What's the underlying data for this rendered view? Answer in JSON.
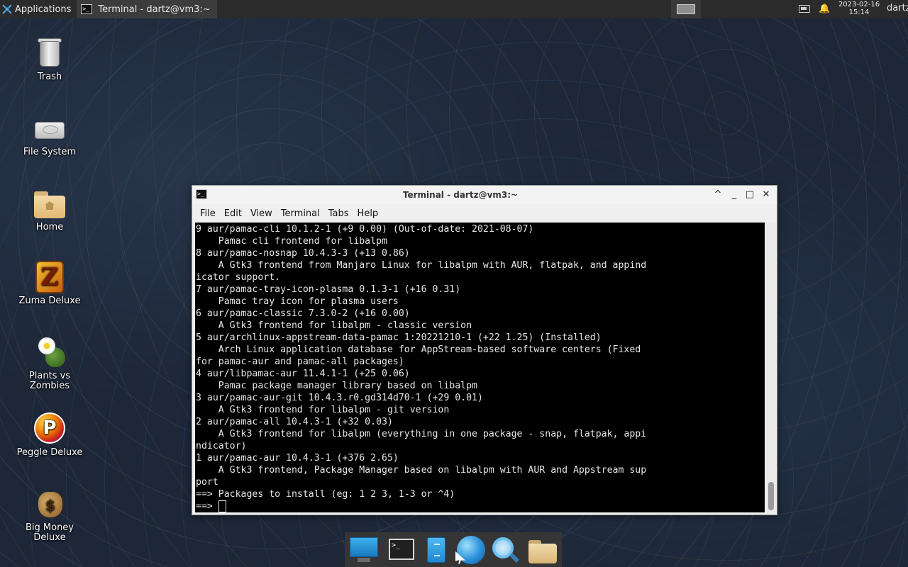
{
  "top_panel": {
    "applications_label": "Applications",
    "task_title": "Terminal - dartz@vm3:~",
    "clock_date": "2023-02-16",
    "clock_time": "15:14",
    "user": "dartz",
    "icons": [
      "applications-icon",
      "terminal-icon",
      "workspace-icon",
      "battery-icon",
      "notification-bell-icon"
    ]
  },
  "desktop_icons": [
    {
      "label": "Trash",
      "icon": "trash-icon"
    },
    {
      "label": "File System",
      "icon": "drive-icon"
    },
    {
      "label": "Home",
      "icon": "home-folder-icon"
    },
    {
      "label": "Zuma Deluxe",
      "icon": "zuma-icon"
    },
    {
      "label": "Plants vs Zombies",
      "icon": "plants-vs-zombies-icon"
    },
    {
      "label": "Peggle Deluxe",
      "icon": "peggle-icon"
    },
    {
      "label": "Big Money Deluxe",
      "icon": "money-bag-icon"
    }
  ],
  "window": {
    "title": "Terminal - dartz@vm3:~",
    "buttons": {
      "up": "^",
      "minimize": "_",
      "maximize": "□",
      "close": "✕"
    },
    "menu": [
      "File",
      "Edit",
      "View",
      "Terminal",
      "Tabs",
      "Help"
    ],
    "terminal_lines": [
      "9 aur/pamac-cli 10.1.2-1 (+9 0.00) (Out-of-date: 2021-08-07)",
      "    Pamac cli frontend for libalpm",
      "8 aur/pamac-nosnap 10.4.3-3 (+13 0.86)",
      "    A Gtk3 frontend from Manjaro Linux for libalpm with AUR, flatpak, and appind",
      "icator support.",
      "7 aur/pamac-tray-icon-plasma 0.1.3-1 (+16 0.31)",
      "    Pamac tray icon for plasma users",
      "6 aur/pamac-classic 7.3.0-2 (+16 0.00)",
      "    A Gtk3 frontend for libalpm - classic version",
      "5 aur/archlinux-appstream-data-pamac 1:20221210-1 (+22 1.25) (Installed)",
      "    Arch Linux application database for AppStream-based software centers (Fixed",
      "for pamac-aur and pamac-all packages)",
      "4 aur/libpamac-aur 11.4.1-1 (+25 0.06)",
      "    Pamac package manager library based on libalpm",
      "3 aur/pamac-aur-git 10.4.3.r0.gd314d70-1 (+29 0.01)",
      "    A Gtk3 frontend for libalpm - git version",
      "2 aur/pamac-all 10.4.3-1 (+32 0.03)",
      "    A Gtk3 frontend for libalpm (everything in one package - snap, flatpak, appi",
      "ndicator)",
      "1 aur/pamac-aur 10.4.3-1 (+376 2.65)",
      "    A Gtk3 frontend, Package Manager based on libalpm with AUR and Appstream sup",
      "port",
      "==> Packages to install (eg: 1 2 3, 1-3 or ^4)"
    ],
    "prompt": "==> "
  },
  "dock": [
    "show-desktop-icon",
    "terminal-icon",
    "file-manager-icon",
    "web-browser-icon",
    "app-finder-icon",
    "folder-icon"
  ],
  "colors": {
    "panel": "#2b2b2b",
    "terminal_bg": "#000000",
    "terminal_fg": "#e6e6e6",
    "window_bg": "#efefef"
  }
}
